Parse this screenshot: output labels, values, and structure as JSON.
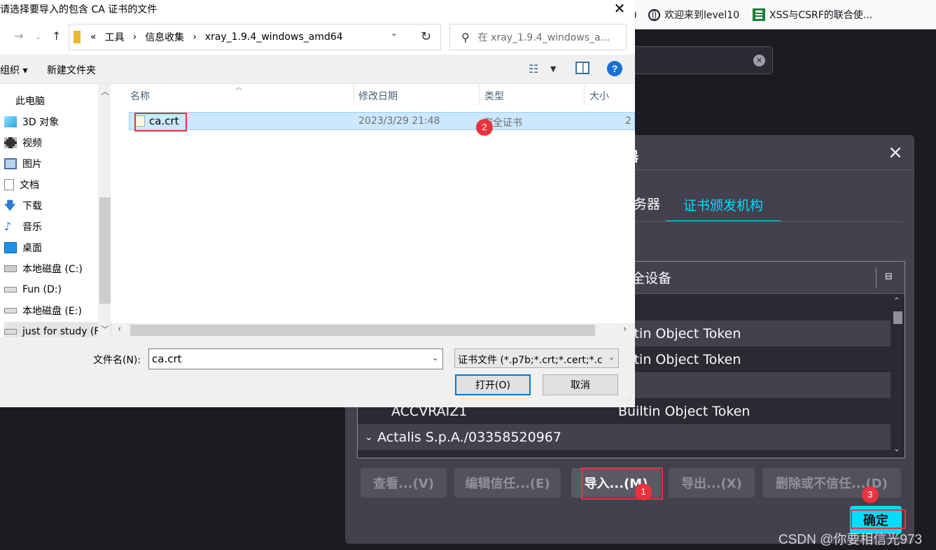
{
  "browser": {
    "bookmarks": [
      {
        "icon": "globe-icon",
        "label": "欢迎来到level10"
      },
      {
        "icon": "sheet-icon",
        "label": "XSS与CSRF的联合使..."
      }
    ]
  },
  "cert_manager": {
    "title": "器",
    "tabs": [
      {
        "label": "务器",
        "active": false
      },
      {
        "label": "证书颁发机构",
        "active": true
      }
    ],
    "column_header": "安全设备",
    "rows": [
      {
        "name": "",
        "token": ""
      },
      {
        "name": "",
        "token": "uiltin Object Token"
      },
      {
        "name": "",
        "token": "uiltin Object Token"
      },
      {
        "name": "",
        "token": ""
      },
      {
        "name": "ACCVRAIZ1",
        "token": "Builtin Object Token"
      },
      {
        "name": "Actalis S.p.A./03358520967",
        "token": "",
        "group": true
      }
    ],
    "buttons": {
      "view": "查看...(V)",
      "edit": "编辑信任...(E)",
      "import": "导入...(M)",
      "export": "导出...(X)",
      "delete": "删除或不信任...(D)",
      "ok": "确定"
    },
    "accent_color": "#00ddff"
  },
  "annotations": {
    "badges": [
      "1",
      "2",
      "3"
    ],
    "color": "#e8333f"
  },
  "watermark": "CSDN @你要相信光973",
  "file_dialog": {
    "title": "请选择要导入的包含 CA 证书的文件",
    "breadcrumb": [
      "«",
      "工具",
      "›",
      "信息收集",
      "›",
      "xray_1.9.4_windows_amd64"
    ],
    "search_placeholder": "在 xray_1.9.4_windows_a...",
    "toolbar": {
      "organize": "组织 ▾",
      "new_folder": "新建文件夹"
    },
    "nav_items": [
      {
        "label": "此电脑",
        "icon": "computer-icon"
      },
      {
        "label": "3D 对象",
        "icon": "cube-icon"
      },
      {
        "label": "视频",
        "icon": "film-icon"
      },
      {
        "label": "图片",
        "icon": "picture-icon"
      },
      {
        "label": "文档",
        "icon": "document-icon"
      },
      {
        "label": "下载",
        "icon": "download-arrow-icon"
      },
      {
        "label": "音乐",
        "icon": "music-note-icon"
      },
      {
        "label": "桌面",
        "icon": "desktop-icon"
      },
      {
        "label": "本地磁盘 (C:)",
        "icon": "windows-drive-icon"
      },
      {
        "label": "Fun (D:)",
        "icon": "drive-icon"
      },
      {
        "label": "本地磁盘 (E:)",
        "icon": "drive-icon"
      },
      {
        "label": "just for study (F",
        "icon": "drive-icon"
      }
    ],
    "columns": {
      "name": "名称",
      "modified": "修改日期",
      "type": "类型",
      "size": "大小"
    },
    "files": [
      {
        "name": "ca.crt",
        "modified": "2023/3/29 21:48",
        "type": "安全证书",
        "size": "2",
        "selected": true
      }
    ],
    "filename_label": "文件名(N):",
    "filename_value": "ca.crt",
    "filter_value": "证书文件 (*.p7b;*.crt;*.cert;*.c",
    "open_button": "打开(O)",
    "cancel_button": "取消"
  }
}
